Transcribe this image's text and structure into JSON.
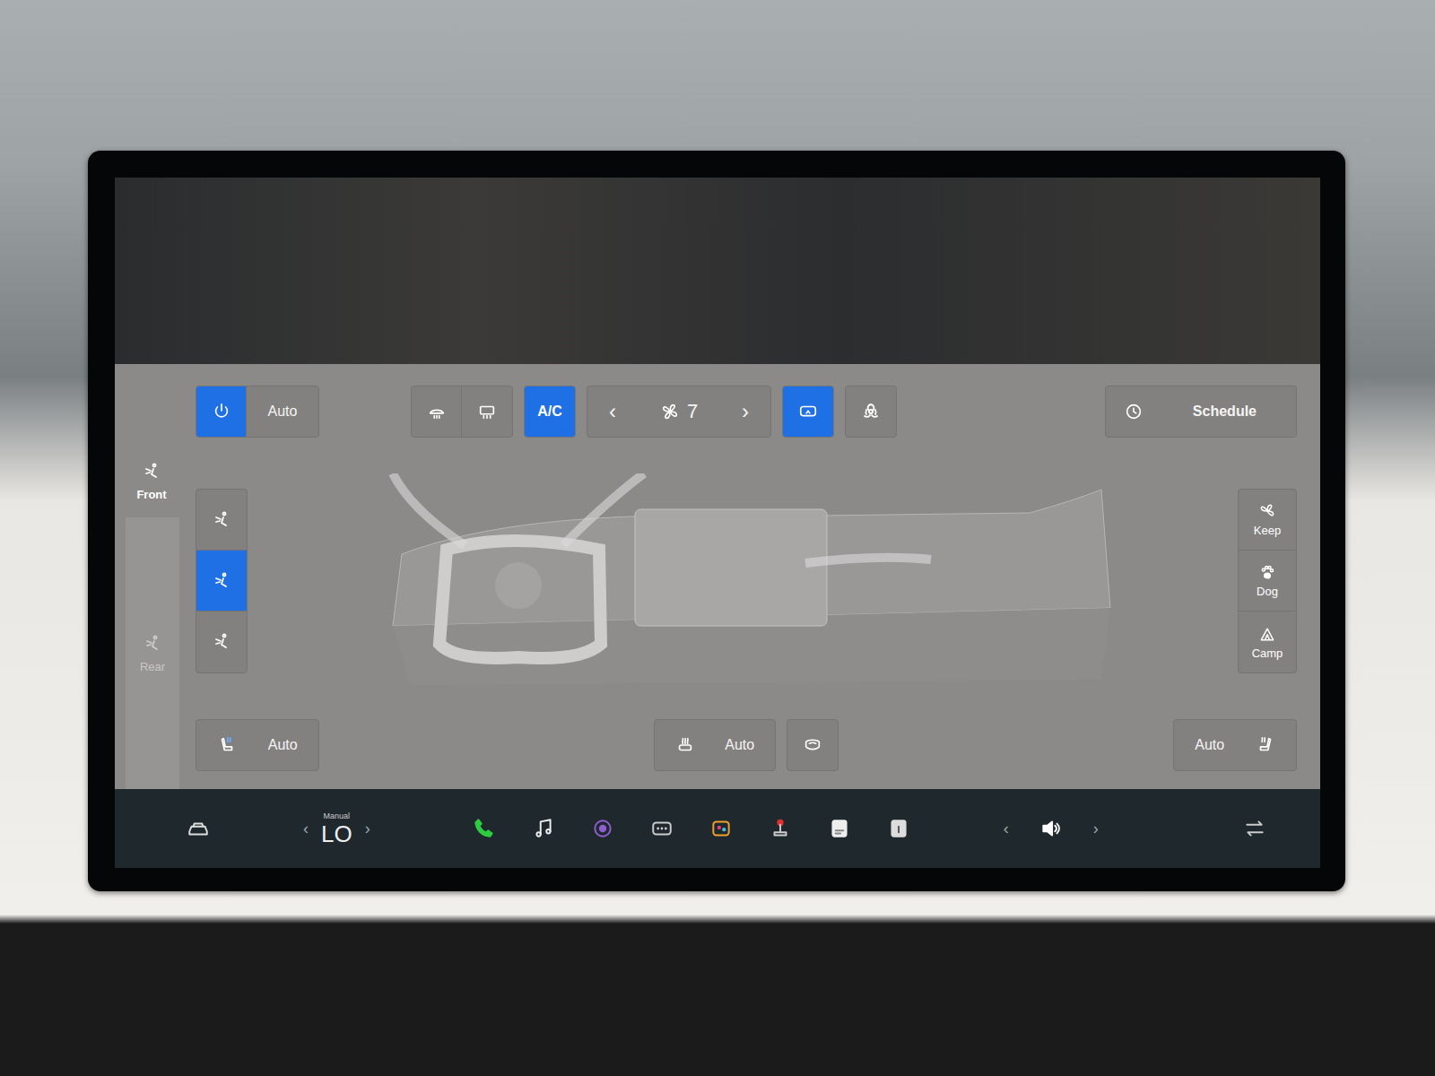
{
  "climate": {
    "power_on": true,
    "auto": "Auto",
    "front_defrost_on": false,
    "rear_defrost_on": false,
    "ac": {
      "label": "A/C",
      "on": true
    },
    "fan": {
      "prev": "‹",
      "speed": "7",
      "next": "›"
    },
    "recirculate_on": true,
    "bioweapon_on": false,
    "schedule": "Schedule"
  },
  "zones": [
    {
      "label": "Front",
      "selected": true
    },
    {
      "label": "Rear",
      "selected": false
    }
  ],
  "vent_modes": [
    {
      "selected": false
    },
    {
      "selected": true
    },
    {
      "selected": false
    }
  ],
  "modes": [
    {
      "label": "Keep"
    },
    {
      "label": "Dog"
    },
    {
      "label": "Camp"
    }
  ],
  "bottom": {
    "driver_seat": "Auto",
    "wheel": "Auto",
    "passenger_seat": "Auto"
  },
  "taskbar": {
    "temp_mode": "Manual",
    "temp": "LO",
    "temp_left": "‹",
    "temp_right": "›",
    "vol_left": "‹",
    "vol_right": "›"
  }
}
